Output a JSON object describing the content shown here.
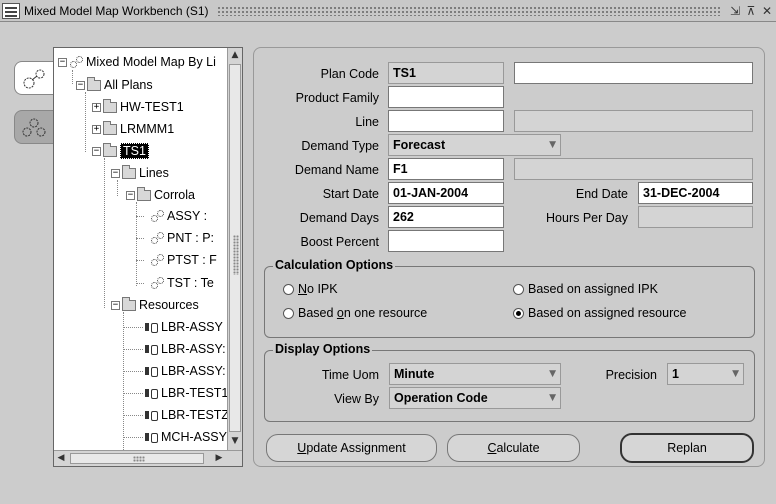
{
  "window": {
    "title": "Mixed Model Map Workbench (S1)",
    "controls": [
      "⇲",
      "⊼",
      "✕"
    ]
  },
  "tree": {
    "nodes": [
      {
        "label": "Mixed Model Map By Li",
        "icon": "gear-icon",
        "toggle": "−"
      },
      {
        "label": "All Plans",
        "icon": "folder-icon",
        "toggle": "−"
      },
      {
        "label": "HW-TEST1",
        "icon": "folder-icon",
        "toggle": "+"
      },
      {
        "label": "LRMMM1",
        "icon": "folder-icon",
        "toggle": "+"
      },
      {
        "label": "TS1",
        "icon": "folder-icon",
        "toggle": "−",
        "selected": true
      },
      {
        "label": "Lines",
        "icon": "folder-icon",
        "toggle": "−"
      },
      {
        "label": "Corrola",
        "icon": "folder-icon",
        "toggle": "−"
      },
      {
        "label": "ASSY :",
        "icon": "gear-icon"
      },
      {
        "label": "PNT : P:",
        "icon": "gear-icon"
      },
      {
        "label": "PTST : F",
        "icon": "gear-icon"
      },
      {
        "label": "TST : Te",
        "icon": "gear-icon"
      },
      {
        "label": "Resources",
        "icon": "folder-icon",
        "toggle": "−"
      },
      {
        "label": "LBR-ASSY",
        "icon": "resource-icon"
      },
      {
        "label": "LBR-ASSY:",
        "icon": "resource-icon"
      },
      {
        "label": "LBR-ASSY:",
        "icon": "resource-icon"
      },
      {
        "label": "LBR-TEST1",
        "icon": "resource-icon"
      },
      {
        "label": "LBR-TESTZ",
        "icon": "resource-icon"
      },
      {
        "label": "MCH-ASSY",
        "icon": "resource-icon"
      }
    ]
  },
  "form": {
    "plan_code_label": "Plan Code",
    "plan_code": "TS1",
    "plan_desc": "",
    "product_family_label": "Product Family",
    "product_family": "",
    "line_label": "Line",
    "line": "",
    "line_desc": "",
    "demand_type_label": "Demand Type",
    "demand_type": "Forecast",
    "demand_name_label": "Demand Name",
    "demand_name": "F1",
    "demand_desc": "",
    "start_date_label": "Start Date",
    "start_date": "01-JAN-2004",
    "end_date_label": "End Date",
    "end_date": "31-DEC-2004",
    "demand_days_label": "Demand Days",
    "demand_days": "262",
    "hours_per_day_label": "Hours Per Day",
    "hours_per_day": "",
    "boost_percent_label": "Boost Percent",
    "boost_percent": ""
  },
  "calc_options": {
    "title": "Calculation Options",
    "no_ipk_u": "N",
    "no_ipk_rest": "o IPK",
    "assigned_ipk": "Based on assigned IPK",
    "one_resource_a": "Based ",
    "one_resource_u": "o",
    "one_resource_b": "n one resource",
    "assigned_resource": "Based on assigned resource",
    "selected": "assigned_resource"
  },
  "display_options": {
    "title": "Display Options",
    "time_uom_label": "Time Uom",
    "time_uom": "Minute",
    "precision_label": "Precision",
    "precision": "1",
    "view_by_label": "View By",
    "view_by": "Operation Code"
  },
  "buttons": {
    "update_u": "U",
    "update_rest": "pdate Assignment",
    "calculate_u": "C",
    "calculate_rest": "alculate",
    "replan": "Replan"
  }
}
